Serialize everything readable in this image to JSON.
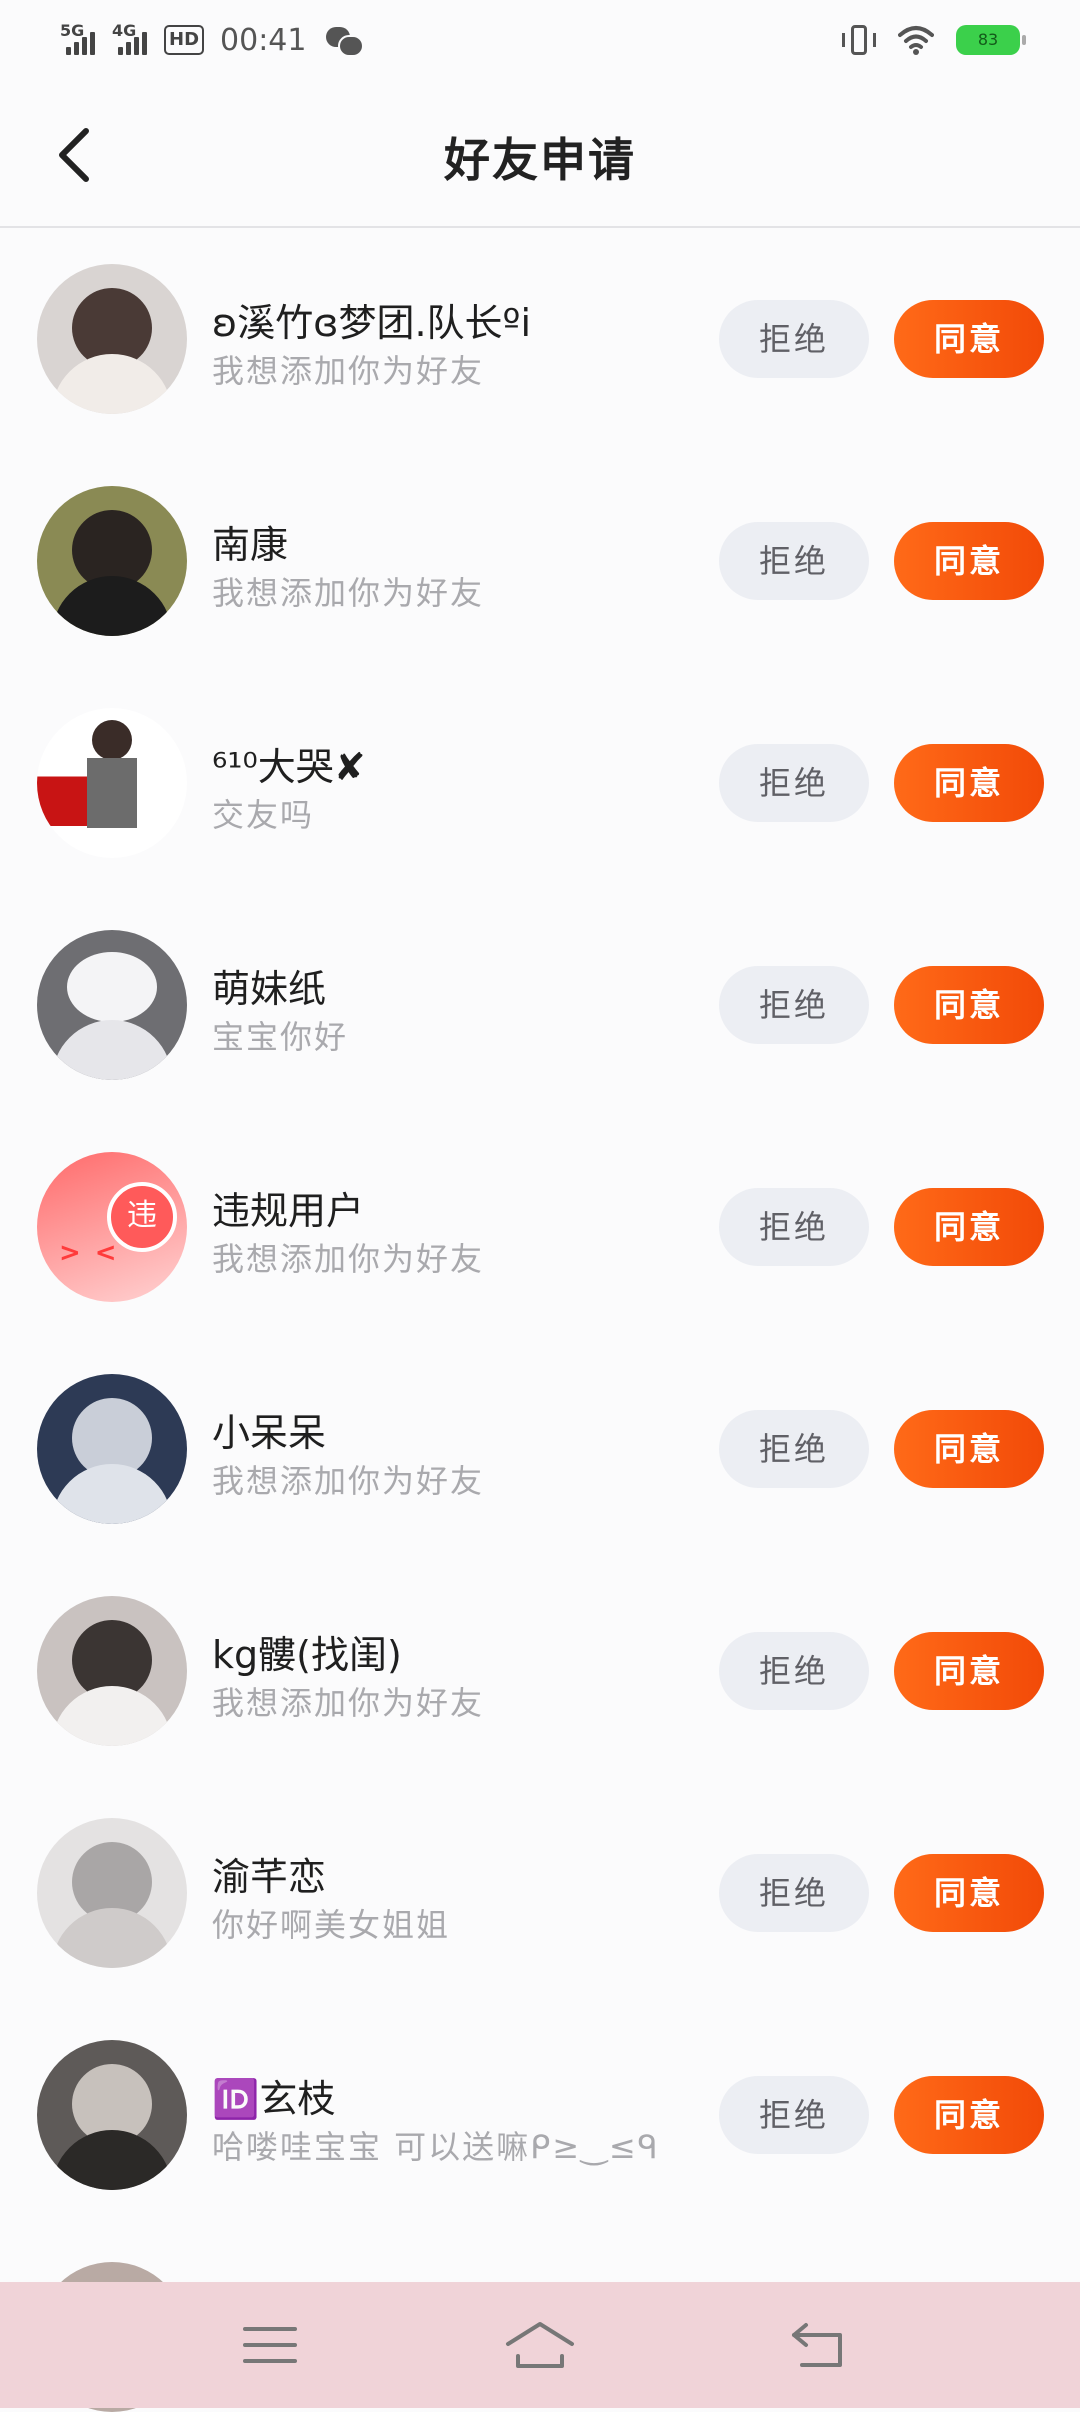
{
  "status_bar": {
    "signal1": "5G",
    "signal2": "4G",
    "hd": "HD",
    "time": "00:41",
    "battery": "83"
  },
  "header": {
    "title": "好友申请"
  },
  "buttons": {
    "reject": "拒绝",
    "accept": "同意"
  },
  "requests": [
    {
      "name": "ʚ溪竹ɞ梦团.队长ºi",
      "message": "我想添加你为好友"
    },
    {
      "name": "南康",
      "message": "我想添加你为好友"
    },
    {
      "name": "⁶¹⁰大哭✘",
      "message": "交友吗"
    },
    {
      "name": "萌妹纸",
      "message": "宝宝你好"
    },
    {
      "name": "违规用户",
      "message": "我想添加你为好友"
    },
    {
      "name": "小呆呆",
      "message": "我想添加你为好友"
    },
    {
      "name": "kg髏(找闺)",
      "message": "我想添加你为好友"
    },
    {
      "name": "渝芊恋",
      "message": "你好啊美女姐姐"
    },
    {
      "name": "🆔玄枝",
      "message": "哈喽哇宝宝 可以送嘛ᑭ≥‿≤ᑫ"
    }
  ],
  "avatars": {
    "violation_badge": "违",
    "violation_eyes": "><"
  },
  "icons": {
    "back": "chevron-left-icon",
    "menu": "menu-icon",
    "home": "home-icon",
    "return": "return-icon"
  },
  "colors": {
    "accept": "#f4560c",
    "reject_bg": "#eceef3",
    "navbar": "#f0d3d8"
  }
}
